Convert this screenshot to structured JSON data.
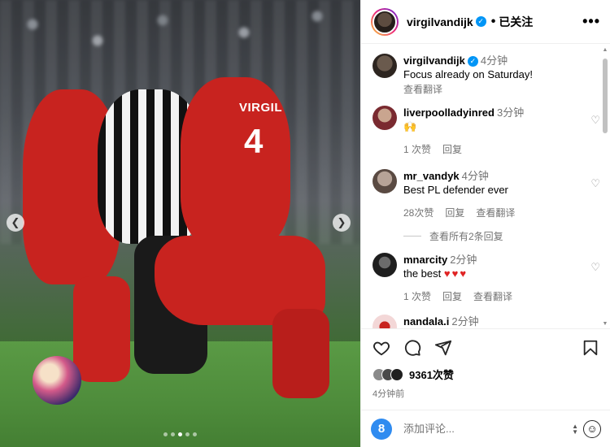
{
  "post": {
    "author": "virgilvandijk",
    "follow_state": "已关注",
    "more_icon": "more-horizontal-icon",
    "jersey_name": "VIRGIL",
    "jersey_number": "4",
    "carousel": {
      "count": 5,
      "active_index": 2
    }
  },
  "caption": {
    "user": "virgilvandijk",
    "time": "4分钟",
    "text": "Focus already on Saturday!",
    "translate": "查看翻译"
  },
  "comments": [
    {
      "user": "liverpoolladyinred",
      "time": "3分钟",
      "text": "🙌",
      "likes": "1 次赞",
      "reply": "回复",
      "translate": ""
    },
    {
      "user": "mr_vandyk",
      "time": "4分钟",
      "text": "Best PL defender ever",
      "likes": "28次赞",
      "reply": "回复",
      "translate": "查看翻译"
    },
    {
      "user": "mnarcity",
      "time": "2分钟",
      "text": "the best",
      "hearts": "♥♥♥",
      "likes": "1 次赞",
      "reply": "回复",
      "translate": "查看翻译"
    },
    {
      "user": "nandala.i",
      "time": "2分钟"
    }
  ],
  "view_replies": "查看所有2条回复",
  "actions": {
    "like_icon": "heart-icon",
    "comment_icon": "comment-icon",
    "share_icon": "send-icon",
    "save_icon": "bookmark-icon",
    "likes_count": "9361次赞",
    "posted_time": "4分钟前"
  },
  "composer": {
    "placeholder": "添加评论...",
    "avatar_letter": "8",
    "emoji_icon": "emoji-icon"
  },
  "colors": {
    "accent": "#0095f6",
    "heart_red": "#e02424",
    "lfc_red": "#c8231f"
  }
}
